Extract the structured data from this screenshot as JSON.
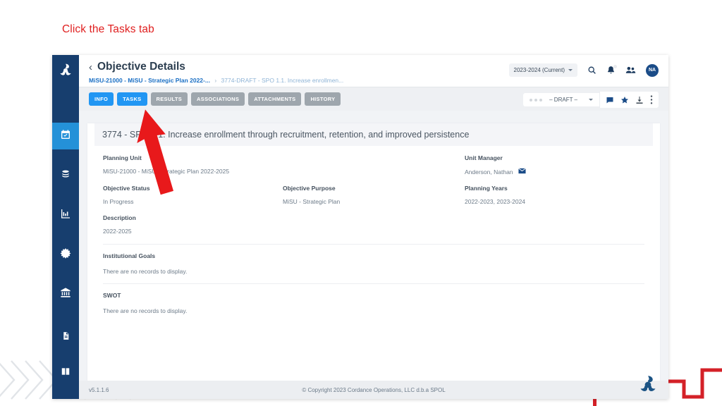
{
  "annotation": {
    "caption": "Click the Tasks tab",
    "caption_color": "#e02020",
    "arrow_color": "#e8191b",
    "arrow_target": "tasks-tab"
  },
  "header": {
    "back_label": "‹",
    "title": "Objective Details",
    "year_selector": "2023-2024 (Current)",
    "avatar_initials": "NA",
    "icons": [
      "search-icon",
      "bell-icon",
      "people-icon"
    ]
  },
  "breadcrumb": {
    "parent": "MiSU-21000 - MiSU - Strategic Plan 2022-...",
    "separator": "›",
    "current": "3774-DRAFT - SPO 1.1. Increase enrollmen..."
  },
  "tabs": [
    {
      "label": "INFO",
      "active": true,
      "name": "tab-info"
    },
    {
      "label": "TASKS",
      "active": true,
      "name": "tab-tasks"
    },
    {
      "label": "RESULTS",
      "active": false,
      "name": "tab-results"
    },
    {
      "label": "ASSOCIATIONS",
      "active": false,
      "name": "tab-associations"
    },
    {
      "label": "ATTACHMENTS",
      "active": false,
      "name": "tab-attachments"
    },
    {
      "label": "HISTORY",
      "active": false,
      "name": "tab-history"
    }
  ],
  "toolbar": {
    "status_value": "– DRAFT –",
    "icons": [
      "comment-icon",
      "star-icon",
      "download-icon",
      "kebab-menu-icon"
    ]
  },
  "record": {
    "title": "3774 - SPO 1.1. Increase enrollment through recruitment, retention, and improved persistence",
    "fields": {
      "planning_unit_label": "Planning Unit",
      "planning_unit_value": "MiSU-21000 - MiSU - Strategic Plan 2022-2025",
      "unit_manager_label": "Unit Manager",
      "unit_manager_value": "Anderson, Nathan",
      "objective_status_label": "Objective Status",
      "objective_status_value": "In Progress",
      "objective_purpose_label": "Objective Purpose",
      "objective_purpose_value": "MiSU - Strategic Plan",
      "planning_years_label": "Planning Years",
      "planning_years_value": "2022-2023, 2023-2024",
      "description_label": "Description",
      "description_value": "2022-2025"
    },
    "sections": [
      {
        "label": "Institutional Goals",
        "value": "There are no records to display."
      },
      {
        "label": "SWOT",
        "value": "There are no records to display."
      }
    ]
  },
  "sidebar": {
    "logo": "spol-pinwheel-logo",
    "items": [
      {
        "name": "sidebar-item-planning",
        "icon": "calendar-check-icon",
        "active": true
      },
      {
        "name": "sidebar-item-budget",
        "icon": "coins-stack-icon",
        "active": false
      },
      {
        "name": "sidebar-item-reports",
        "icon": "bar-chart-icon",
        "active": false
      },
      {
        "name": "sidebar-item-assessment",
        "icon": "starburst-icon",
        "active": false
      },
      {
        "name": "sidebar-item-institution",
        "icon": "bank-building-icon",
        "active": false
      }
    ],
    "bottom_items": [
      {
        "name": "sidebar-item-documents",
        "icon": "document-icon"
      },
      {
        "name": "sidebar-item-help",
        "icon": "book-icon"
      }
    ]
  },
  "footer": {
    "version": "v5.1.1.6",
    "copyright": "© Copyright 2023 Cordance Operations, LLC d.b.a SPOL"
  },
  "colors": {
    "rail_navy": "#173e6e",
    "tab_active": "#2196f3",
    "tab_inactive": "#9ea6ad",
    "brand_blue": "#1b4c88",
    "annotation_red": "#e02020"
  }
}
